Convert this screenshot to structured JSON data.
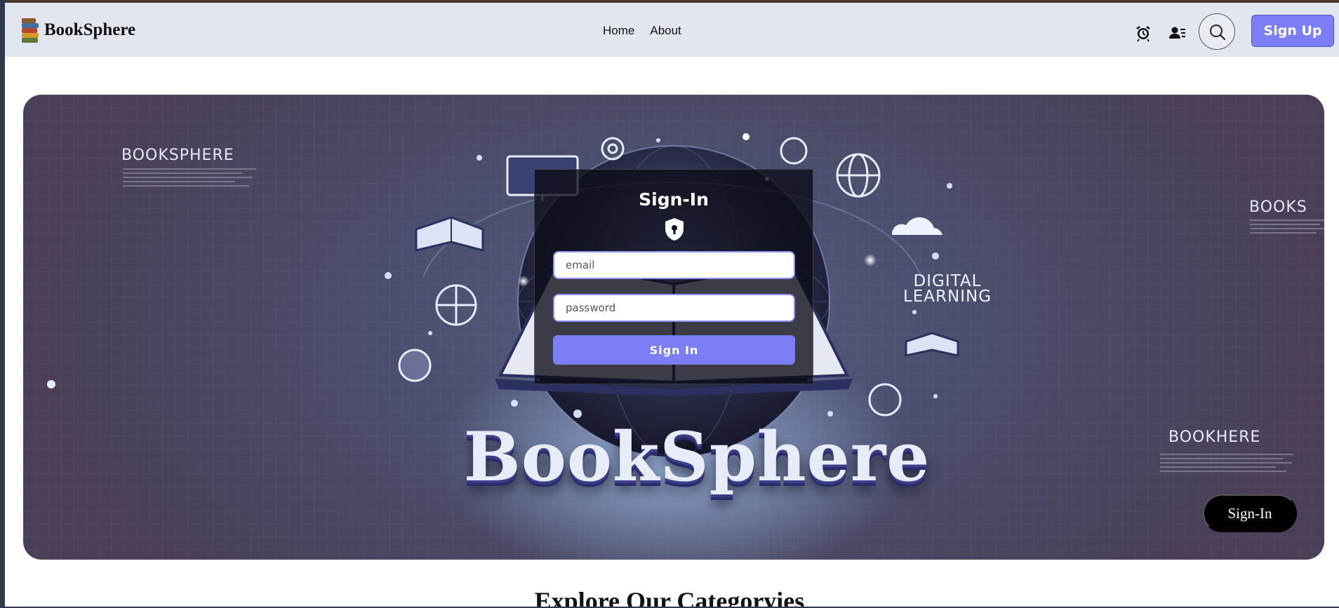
{
  "navbar": {
    "brand": "BookSphere",
    "links": [
      "Home",
      "About"
    ],
    "signup_label": "Sign Up"
  },
  "hero": {
    "side_text_left": "BOOKSPHERE",
    "side_text_right_top": "BOOKS",
    "side_text_right_bottom": "BOOKHERE",
    "digital_line1": "DIGITAL",
    "digital_line2": "LEARNING",
    "big_title": "BookSphere",
    "signin_button": "Sign-In"
  },
  "signin_card": {
    "title": "Sign-In",
    "email_placeholder": "email",
    "password_placeholder": "password",
    "submit_label": "Sign In"
  },
  "section": {
    "title": "Explore Our Categoryies"
  },
  "colors": {
    "accent": "#7b7ef4",
    "navbar_bg": "#e2e6ee"
  }
}
